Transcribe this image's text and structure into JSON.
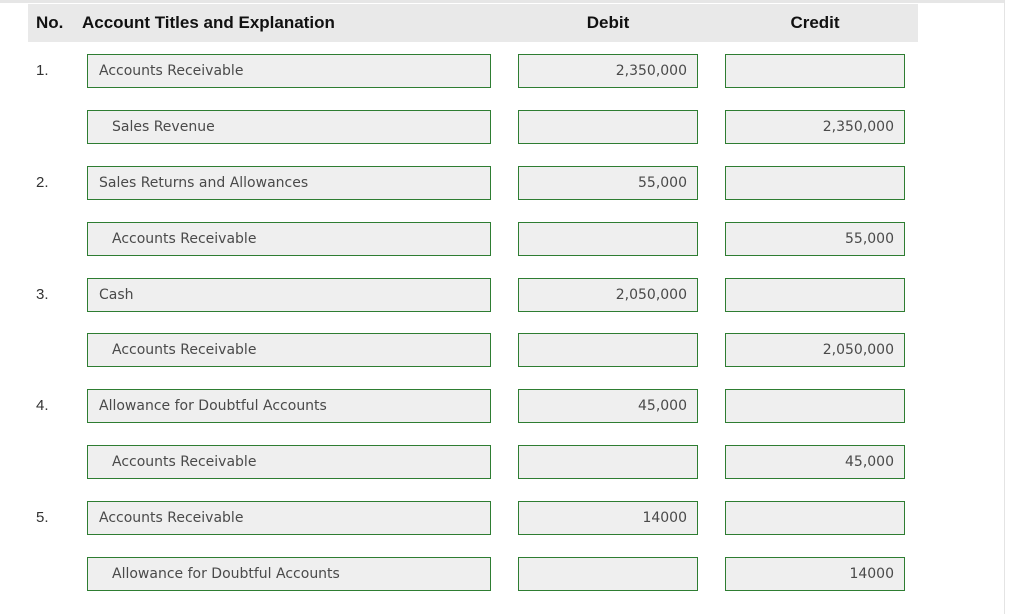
{
  "header": {
    "no_label": "No.",
    "title_label": "Account Titles and Explanation",
    "debit_label": "Debit",
    "credit_label": "Credit"
  },
  "entries": [
    {
      "number": "1.",
      "lines": [
        {
          "account": "Accounts Receivable",
          "debit": "2,350,000",
          "credit": ""
        },
        {
          "account": "Sales Revenue",
          "debit": "",
          "credit": "2,350,000"
        }
      ]
    },
    {
      "number": "2.",
      "lines": [
        {
          "account": "Sales Returns and Allowances",
          "debit": "55,000",
          "credit": ""
        },
        {
          "account": "Accounts Receivable",
          "debit": "",
          "credit": "55,000"
        }
      ]
    },
    {
      "number": "3.",
      "lines": [
        {
          "account": "Cash",
          "debit": "2,050,000",
          "credit": ""
        },
        {
          "account": "Accounts Receivable",
          "debit": "",
          "credit": "2,050,000"
        }
      ]
    },
    {
      "number": "4.",
      "lines": [
        {
          "account": "Allowance for Doubtful Accounts",
          "debit": "45,000",
          "credit": ""
        },
        {
          "account": "Accounts Receivable",
          "debit": "",
          "credit": "45,000"
        }
      ]
    },
    {
      "number": "5.",
      "lines": [
        {
          "account": "Accounts Receivable",
          "debit": "14000",
          "credit": ""
        },
        {
          "account": "Allowance for Doubtful Accounts",
          "debit": "",
          "credit": "14000"
        }
      ]
    }
  ],
  "colors": {
    "field_border": "#2e7d32",
    "field_background": "#efefef",
    "header_background": "#e9e9e9"
  }
}
